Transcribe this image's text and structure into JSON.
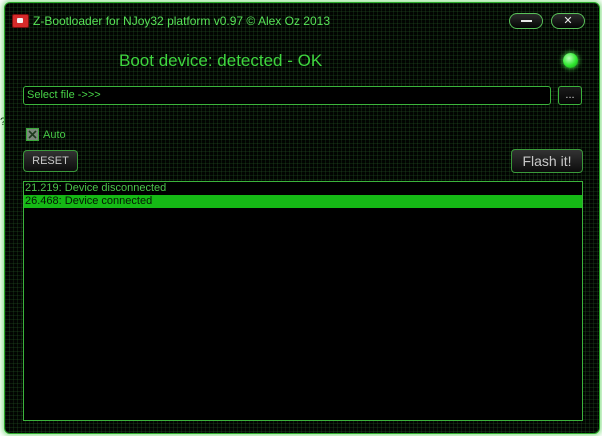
{
  "stray_text": "?",
  "window": {
    "title": "Z-Bootloader for NJoy32 platform v0.97 © Alex Oz 2013",
    "minimize_label": "",
    "close_label": "✕"
  },
  "status": {
    "text": "Boot device: detected - OK",
    "led_color": "#2fe82f"
  },
  "file": {
    "placeholder": "Select file ->>>",
    "value": "",
    "browse_label": "..."
  },
  "auto": {
    "label": "Auto",
    "checked": true
  },
  "buttons": {
    "reset_label": "RESET",
    "flash_label": "Flash it!"
  },
  "log": {
    "items": [
      {
        "text": "21.219: Device disconnected",
        "selected": false
      },
      {
        "text": "26.468: Device connected",
        "selected": true
      }
    ]
  },
  "colors": {
    "accent": "#3ed63e",
    "background": "#020402",
    "selection": "#15b915"
  }
}
